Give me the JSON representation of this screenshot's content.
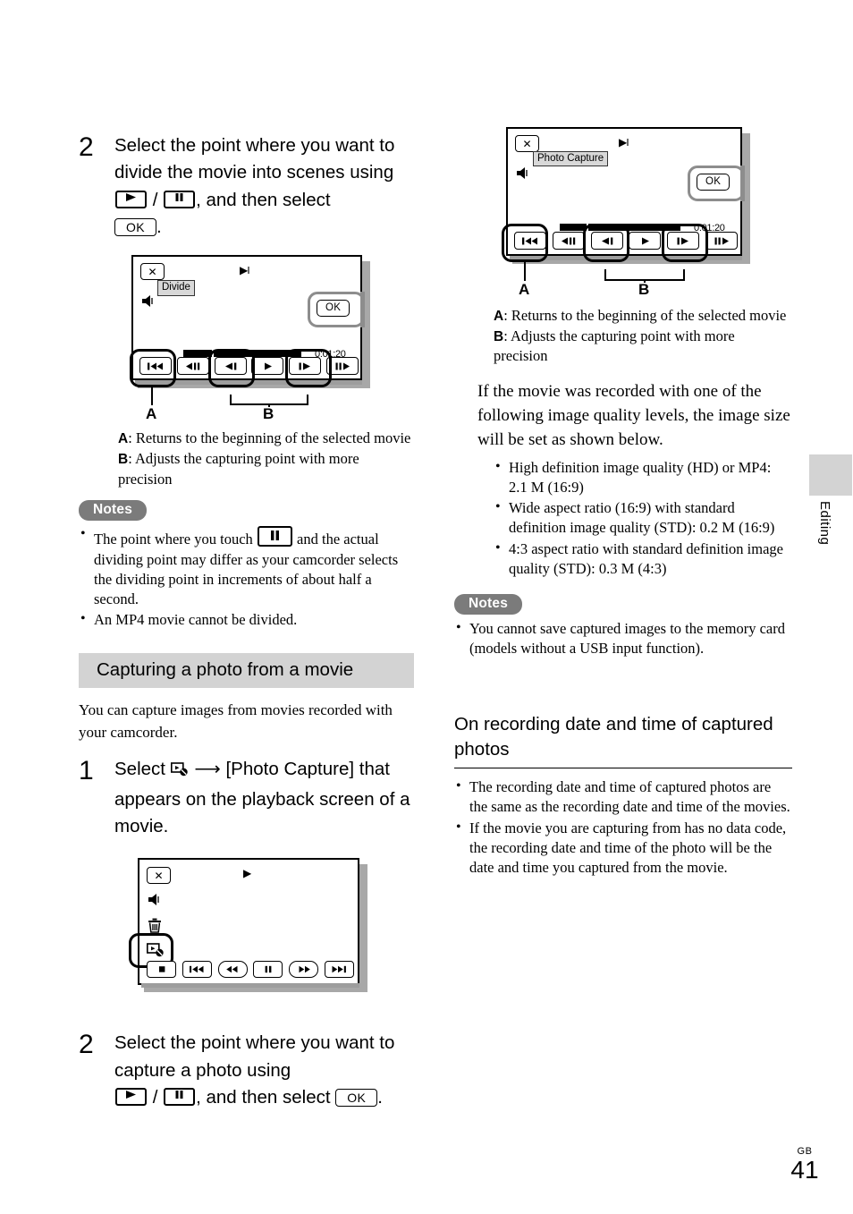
{
  "page": {
    "folio_region": "GB",
    "folio_number": "41",
    "side_tab": "Editing"
  },
  "left_column": {
    "step2_divide": {
      "number": "2",
      "text_part1": "Select the point where you want to divide the movie into scenes using",
      "key_play": "play-icon",
      "separator": "/",
      "key_pause": "pause-icon",
      "text_part2": ", and then select",
      "key_ok": "OK",
      "text_end": "."
    },
    "divide_screen": {
      "close_label": "✕",
      "mode_label": "Divide",
      "playpause_indicator": "▶‖",
      "speaker_icon": "speaker-icon",
      "ok_label": "OK",
      "timecode": "0:01:20",
      "buttons": [
        "go-to-beginning",
        "frame-reverse",
        "step-backward",
        "play",
        "step-forward",
        "frame-advance"
      ],
      "callout_a": "A",
      "callout_b": "B"
    },
    "ab_legend": {
      "a_key": "A",
      "a_text": ":  Returns to the beginning of the selected movie",
      "b_key": "B",
      "b_text": ":  Adjusts the capturing point with more precision"
    },
    "notes": {
      "badge": "Notes",
      "items_pre": "The point where you touch",
      "items_post": "and the actual dividing point may differ as your camcorder selects the dividing point in increments of about half a second.",
      "item2": "An MP4 movie cannot be divided."
    },
    "section": {
      "heading": "Capturing a photo from a movie",
      "intro": "You can capture images from movies recorded with your camcorder."
    },
    "step1_capture": {
      "number": "1",
      "text_part1": "Select",
      "icon": "photo-capture-icon",
      "arrow": "⟶",
      "text_part2": "[Photo Capture] that appears on the playback screen of a movie."
    },
    "playback_screen": {
      "close_label": "✕",
      "play_indicator": "▶",
      "speaker_icon": "speaker-icon",
      "trash_icon": "trash-icon",
      "photo_capture_icon": "photo-capture-icon",
      "buttons": [
        "stop",
        "previous",
        "rewind",
        "pause",
        "fast-forward",
        "next"
      ]
    },
    "step2_capture": {
      "number": "2",
      "text_part1": "Select the point where you want to capture a photo using",
      "key_play": "play-icon",
      "separator": "/",
      "key_pause": "pause-icon",
      "text_part2": ", and then select",
      "key_ok": "OK",
      "text_end": "."
    }
  },
  "right_column": {
    "capture_screen": {
      "close_label": "✕",
      "mode_label": "Photo Capture",
      "playpause_indicator": "▶‖",
      "speaker_icon": "speaker-icon",
      "ok_label": "OK",
      "timecode": "0:01:20",
      "buttons": [
        "go-to-beginning",
        "frame-reverse",
        "step-backward",
        "play",
        "step-forward",
        "frame-advance"
      ],
      "callout_a": "A",
      "callout_b": "B"
    },
    "ab_legend": {
      "a_key": "A",
      "a_text": ":  Returns to the beginning of the selected movie",
      "b_key": "B",
      "b_text": ":  Adjusts the capturing point with more precision"
    },
    "quality_intro": "If the movie was recorded with one of the following image quality levels, the image size will be set as shown below.",
    "quality_bullets": [
      "High definition image quality (HD) or MP4: 2.1 M (16:9)",
      "Wide aspect ratio (16:9) with standard definition image quality (STD): 0.2 M (16:9)",
      "4:3 aspect ratio with standard definition image quality (STD): 0.3 M (4:3)"
    ],
    "notes": {
      "badge": "Notes",
      "items": [
        "You cannot save captured images to the memory card (models without a USB input function)."
      ]
    },
    "date_section": {
      "heading": "On recording date and time of captured photos",
      "bullets": [
        "The recording date and time of captured photos are the same as the recording date and time of the movies.",
        "If the movie you are capturing from has no data code, the recording date and time of the photo will be the date and time you captured from the movie."
      ]
    }
  }
}
